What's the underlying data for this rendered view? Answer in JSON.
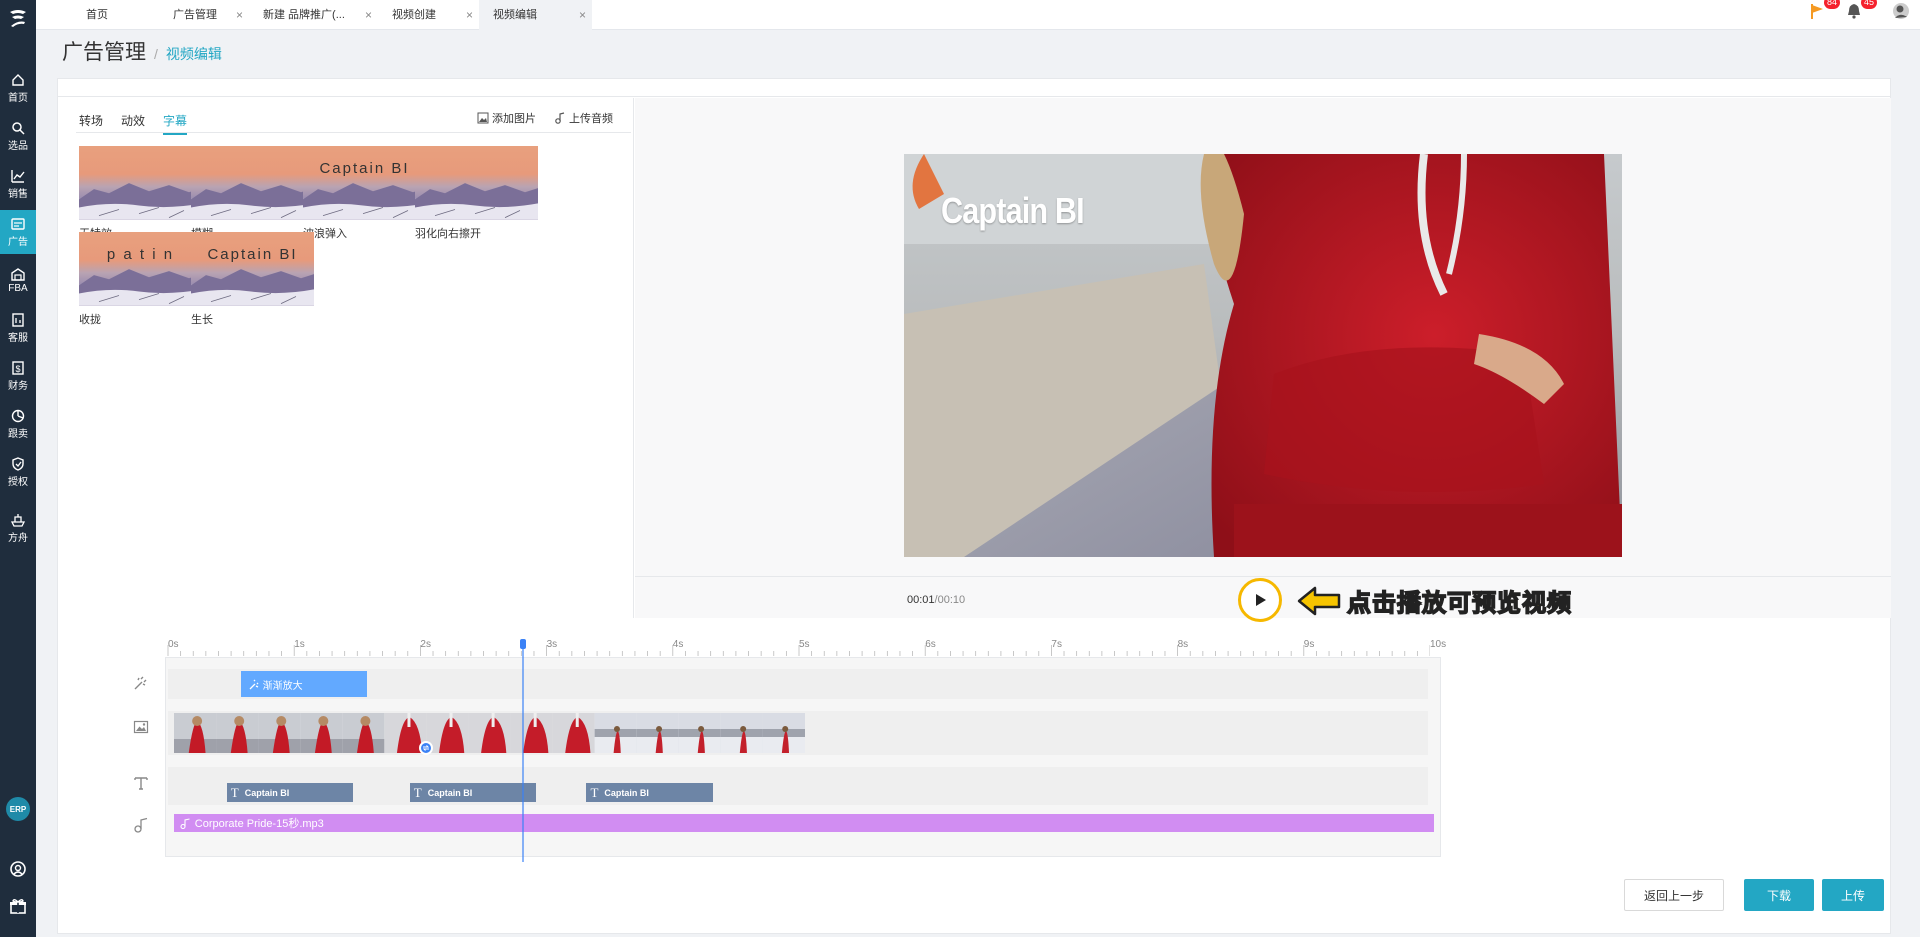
{
  "tabs": [
    {
      "label": "首页",
      "closable": false
    },
    {
      "label": "广告管理",
      "closable": true
    },
    {
      "label": "新建 品牌推广(...",
      "closable": true
    },
    {
      "label": "视频创建",
      "closable": true
    },
    {
      "label": "视频编辑",
      "closable": true,
      "active": true
    }
  ],
  "tab_close_glyph": "×",
  "top_icons": {
    "flag_count": "84",
    "bell_count": "45"
  },
  "sidebar": {
    "items": [
      {
        "label": "首页",
        "icon": "home-icon"
      },
      {
        "label": "选品",
        "icon": "search-icon"
      },
      {
        "label": "销售",
        "icon": "chart-line-icon"
      },
      {
        "label": "广告",
        "icon": "ad-icon",
        "active": true
      },
      {
        "label": "FBA",
        "icon": "warehouse-icon"
      },
      {
        "label": "客服",
        "icon": "report-icon"
      },
      {
        "label": "财务",
        "icon": "dollar-icon"
      },
      {
        "label": "跟卖",
        "icon": "pie-icon"
      },
      {
        "label": "授权",
        "icon": "shield-icon"
      },
      {
        "label": "方舟",
        "icon": "ark-icon"
      }
    ],
    "erp_label": "ERP"
  },
  "breadcrumb": {
    "title": "广告管理",
    "separator": "/",
    "current": "视频编辑"
  },
  "effects": {
    "tabs": [
      "转场",
      "动效",
      "字幕"
    ],
    "active_tab": "字幕",
    "actions": {
      "add_image": "添加图片",
      "upload_audio": "上传音频"
    },
    "items": [
      {
        "label": "无特效",
        "caption": ""
      },
      {
        "label": "模糊",
        "caption": ""
      },
      {
        "label": "波浪弹入",
        "caption": "Captain BI"
      },
      {
        "label": "羽化向右擦开",
        "caption": ""
      },
      {
        "label": "收拢",
        "caption": "p a t i n"
      },
      {
        "label": "生长",
        "caption": "Captain BI"
      }
    ]
  },
  "preview": {
    "video_title": "Captain BI",
    "time_current": "00:01",
    "time_separator": "/",
    "time_total": "00:10",
    "hint": "点击播放可预览视频"
  },
  "timeline": {
    "ruler_labels": [
      "0s",
      "1s",
      "2s",
      "3s",
      "4s",
      "5s",
      "6s",
      "7s",
      "8s",
      "9s",
      "10s"
    ],
    "playhead_seconds": 2.8,
    "effect_clip": {
      "label": "渐渐放大",
      "start": 0.56,
      "end": 1.56
    },
    "text_clips": [
      {
        "label": "Captain BI",
        "start": 0.45,
        "end": 1.45
      },
      {
        "label": "Captain BI",
        "start": 1.9,
        "end": 2.9
      },
      {
        "label": "Captain BI",
        "start": 3.3,
        "end": 4.3
      }
    ],
    "audio_clip": {
      "label": "Corporate Pride-15秒.mp3"
    },
    "video_clips": 3
  },
  "footer": {
    "back": "返回上一步",
    "download": "下载",
    "upload": "上传"
  },
  "colors": {
    "accent": "#23a7c4",
    "sidebar": "#1f2d3d",
    "hint_yellow": "#f6c400",
    "audio": "#d18df2",
    "effect": "#62a9ff",
    "text_clip": "#6d85a6"
  }
}
